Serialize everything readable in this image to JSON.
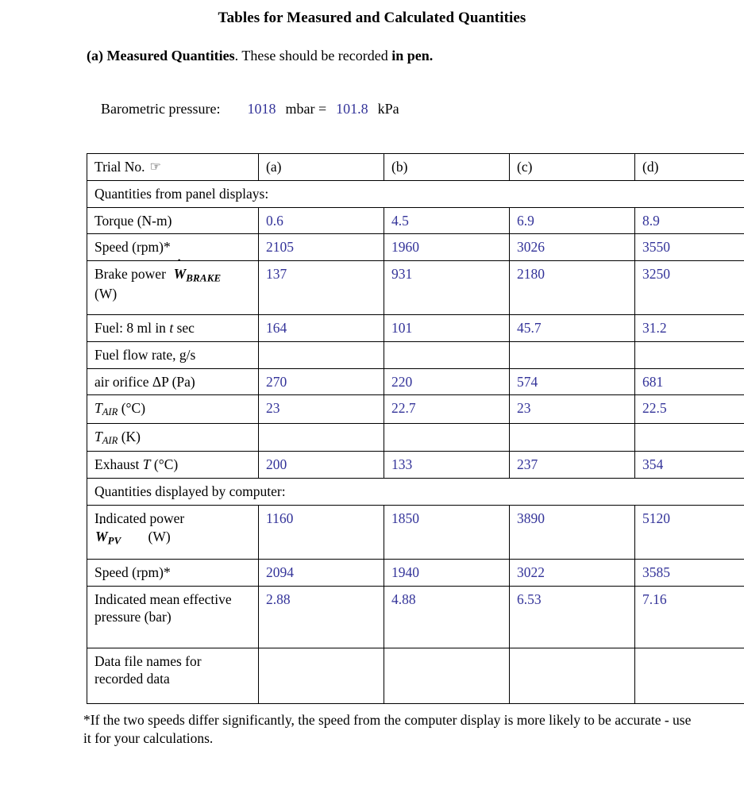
{
  "document": {
    "title": "Tables for Measured and Calculated Quantities",
    "section_intro": {
      "bold_lead": "(a) Measured Quantities",
      "regular_mid": ". These should be recorded ",
      "bold_tail": "in pen."
    },
    "barometric": {
      "label": "Barometric pressure:",
      "mbar_value": "1018",
      "mbar_unit": "mbar =",
      "kpa_value": "101.8",
      "kpa_unit": "kPa"
    },
    "footnote": "*If the two speeds differ significantly, the speed from the computer display is more likely to be accurate - use it for your calculations."
  },
  "table": {
    "header": {
      "row_label": "Trial No.",
      "hand_icon": "pointing-hand-icon",
      "columns": [
        "(a)",
        "(b)",
        "(c)",
        "(d)"
      ]
    },
    "section_panel": "Quantities from panel displays:",
    "section_computer": "Quantities displayed by computer:",
    "rows": [
      {
        "label": "Torque (N-m)",
        "values": [
          "0.6",
          "4.5",
          "6.9",
          "8.9"
        ]
      },
      {
        "label": "Speed (rpm)*",
        "values": [
          "2105",
          "1960",
          "3026",
          "3550"
        ]
      },
      {
        "label_parts": {
          "pre": "Brake power",
          "symbol": "W",
          "dot": "˙",
          "subscript": "BRAKE",
          "post": "(W)"
        },
        "values": [
          "137",
          "931",
          "2180",
          "3250"
        ]
      },
      {
        "label_parts": {
          "pre": "Fuel: 8 ml in",
          "italic": "t",
          "post": "sec"
        },
        "values": [
          "164",
          "101",
          "45.7",
          "31.2"
        ]
      },
      {
        "label": "Fuel flow rate, g/s",
        "values": [
          "",
          "",
          "",
          ""
        ]
      },
      {
        "label": "air orifice ΔP (Pa)",
        "values": [
          "270",
          "220",
          "574",
          "681"
        ]
      },
      {
        "label_parts": {
          "symbol": "T",
          "subscript": "AIR",
          "post": "(°C)"
        },
        "values": [
          "23",
          "22.7",
          "23",
          "22.5"
        ]
      },
      {
        "label_parts": {
          "symbol": "T",
          "subscript": "AIR",
          "post": "(K)"
        },
        "values": [
          "",
          "",
          "",
          ""
        ]
      },
      {
        "label_parts": {
          "pre": "Exhaust",
          "italic": "T",
          "post": "(°C)"
        },
        "values": [
          "200",
          "133",
          "237",
          "354"
        ]
      },
      {
        "label_parts": {
          "pre": "Indicated power",
          "symbol": "W",
          "dot": "˙",
          "subscript": "PV",
          "post": "(W)"
        },
        "values": [
          "1160",
          "1850",
          "3890",
          "5120"
        ]
      },
      {
        "label": "Speed (rpm)*",
        "values": [
          "2094",
          "1940",
          "3022",
          "3585"
        ]
      },
      {
        "label": "Indicated mean effective pressure (bar)",
        "values": [
          "2.88",
          "4.88",
          "6.53",
          "7.16"
        ]
      },
      {
        "label": "Data file names for recorded data",
        "values": [
          "",
          "",
          "",
          ""
        ]
      }
    ]
  },
  "colors": {
    "data_value_blue": "#333399",
    "text_black": "#000000",
    "border": "#000000",
    "page_background": "#ffffff"
  }
}
